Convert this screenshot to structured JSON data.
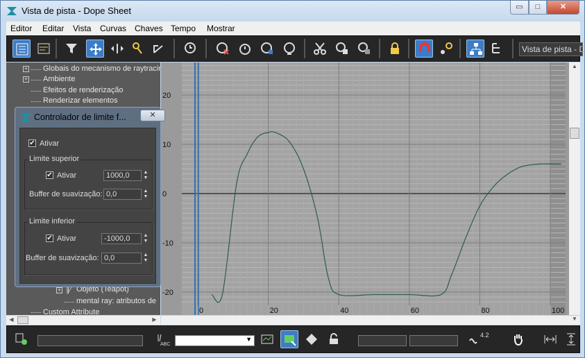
{
  "window": {
    "title": "Vista de pista - Dope Sheet",
    "caption_min": "▭",
    "caption_max": "□",
    "caption_close": "✕"
  },
  "menu": [
    "Editor",
    "Editar",
    "Vista",
    "Curvas",
    "Chaves",
    "Tempo",
    "Mostrar"
  ],
  "toolbar": {
    "icons": [
      "filter-keys-icon",
      "edit-ranges-icon",
      "filter-icon",
      "move-keys-icon",
      "slide-keys-icon",
      "add-keys-icon",
      "scale-keys-icon",
      "select-time-icon",
      "delete-time-icon",
      "reverse-time-icon",
      "scale-time-icon",
      "insert-time-icon",
      "cut-icon",
      "copy-icon",
      "paste-icon",
      "lock-selection-icon",
      "snap-frames-icon",
      "show-keyable-icon",
      "modify-subtree-icon",
      "modify-child-keys-icon"
    ],
    "trackview_name": "Vista de pista - Do"
  },
  "tree": {
    "items": [
      "Globais do mecanismo de raytracing",
      "Ambiente",
      "Efeitos de renderização",
      "Renderizar elementos",
      "Objeto (Teapot)",
      "mental ray: atributos de",
      "Custom Attribute"
    ]
  },
  "dialog": {
    "title": "Controlador de limite f...",
    "close": "✕",
    "enable_label": "Ativar",
    "enable_checked": true,
    "upper": {
      "group": "Limite superior",
      "enable_label": "Ativar",
      "checked": true,
      "value": "1000,0",
      "buffer_label": "Buffer de suavização:",
      "buffer": "0,0"
    },
    "lower": {
      "group": "Limite inferior",
      "enable_label": "Ativar",
      "checked": true,
      "value": "-1000,0",
      "buffer_label": "Buffer de suavização:",
      "buffer": "0,0"
    }
  },
  "chart_data": {
    "type": "line",
    "xlabel": "",
    "ylabel": "",
    "y_ticks": [
      "20",
      "10",
      "0",
      "-10",
      "-20"
    ],
    "x_ticks": [
      "0",
      "20",
      "40",
      "60",
      "80",
      "100"
    ],
    "xlim": [
      -5,
      103
    ],
    "ylim": [
      -22,
      28
    ],
    "current_frame": 0,
    "series": [
      {
        "x": [
          4,
          7,
          11,
          14,
          17,
          20,
          22,
          26,
          30,
          34,
          37,
          40,
          50,
          60,
          69,
          72,
          76,
          80,
          84,
          88,
          92,
          97,
          100,
          103
        ],
        "y": [
          -20.5,
          -20.4,
          2,
          8,
          11.5,
          12.4,
          12.4,
          10.5,
          5,
          -5,
          -17,
          -20.5,
          -20.5,
          -20.5,
          -20.5,
          -16.5,
          -9,
          -2.5,
          1.5,
          4,
          5.5,
          6,
          6,
          6
        ]
      }
    ]
  },
  "statusbar": {
    "icons": [
      "key-icon",
      "rename-icon",
      "zoom-view-icon",
      "zoom-region-icon",
      "pan-icon",
      "zoom-horizontal-icon",
      "zoom-value-icon"
    ],
    "count_label": "4.2"
  },
  "colors": {
    "accent": "#3d7cc6",
    "curve": "#2e5e46",
    "time_slider": "#2e6fb5",
    "toolbar": "#262626"
  }
}
